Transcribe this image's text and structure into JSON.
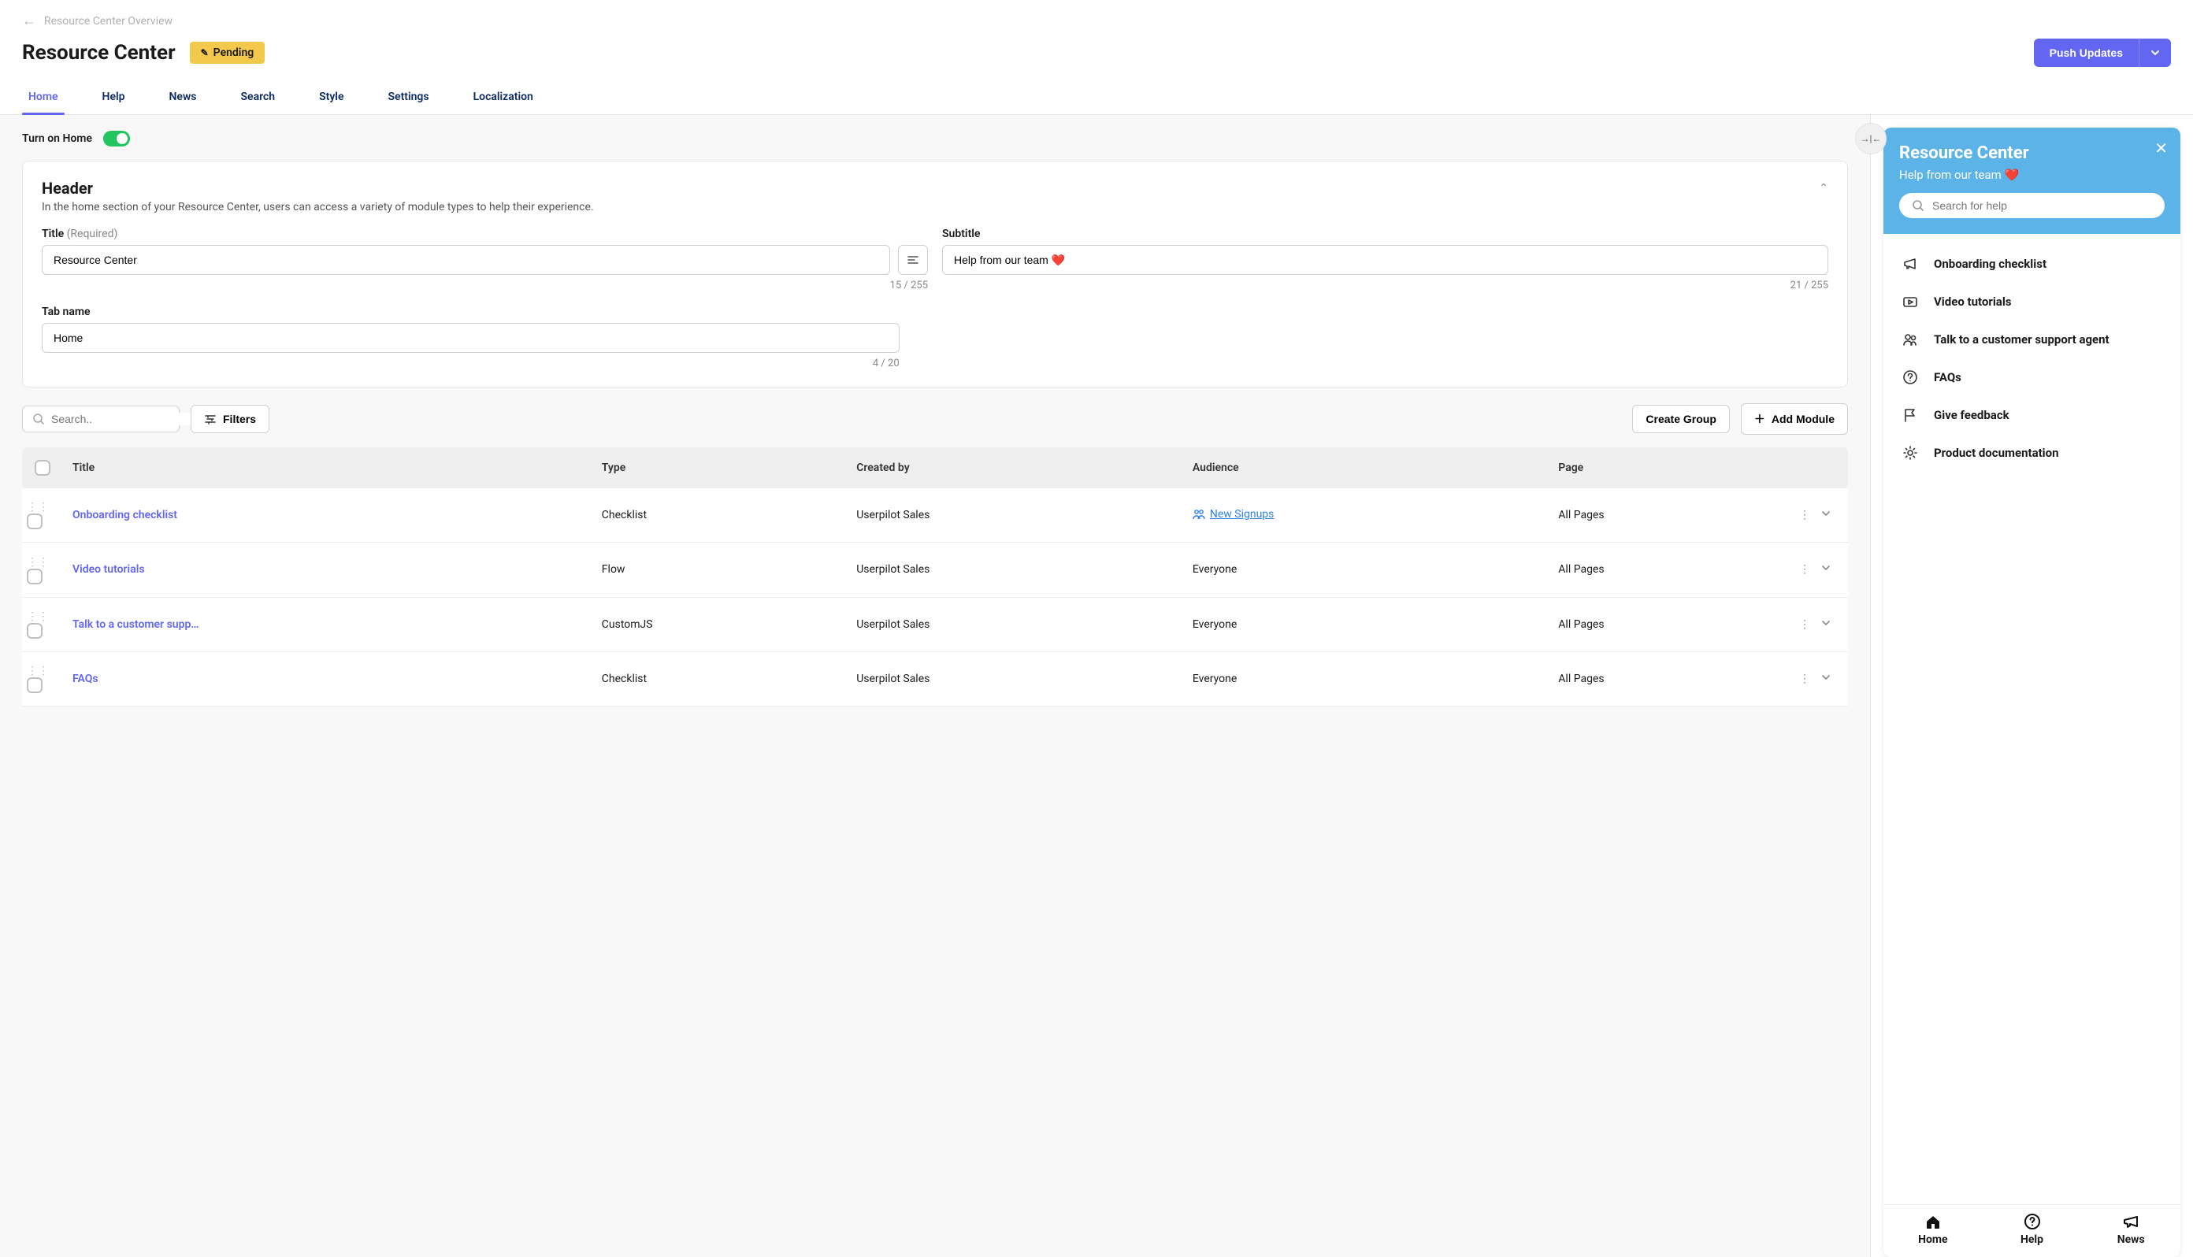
{
  "breadcrumb": {
    "back_label": "Resource Center Overview"
  },
  "page": {
    "title": "Resource Center",
    "badge": "Pending",
    "push_label": "Push Updates"
  },
  "tabs": [
    "Home",
    "Help",
    "News",
    "Search",
    "Style",
    "Settings",
    "Localization"
  ],
  "active_tab": 0,
  "toggle_label": "Turn on Home",
  "header_card": {
    "heading": "Header",
    "desc": "In the home section of your Resource Center, users can access a variety of module types to help their experience.",
    "title_label": "Title",
    "title_required": "(Required)",
    "title_value": "Resource Center",
    "title_counter": "15 / 255",
    "subtitle_label": "Subtitle",
    "subtitle_value": "Help from our team ❤️",
    "subtitle_counter": "21 / 255",
    "tabname_label": "Tab name",
    "tabname_value": "Home",
    "tabname_counter": "4 / 20"
  },
  "toolbar": {
    "search_placeholder": "Search..",
    "filters_label": "Filters",
    "create_group_label": "Create Group",
    "add_module_label": "Add Module"
  },
  "table": {
    "cols": [
      "Title",
      "Type",
      "Created by",
      "Audience",
      "Page"
    ],
    "rows": [
      {
        "title": "Onboarding checklist",
        "type": "Checklist",
        "created_by": "Userpilot Sales",
        "audience": "New Signups",
        "audience_link": true,
        "page": "All Pages"
      },
      {
        "title": "Video tutorials",
        "type": "Flow",
        "created_by": "Userpilot Sales",
        "audience": "Everyone",
        "audience_link": false,
        "page": "All Pages"
      },
      {
        "title": "Talk to a customer supp…",
        "type": "CustomJS",
        "created_by": "Userpilot Sales",
        "audience": "Everyone",
        "audience_link": false,
        "page": "All Pages"
      },
      {
        "title": "FAQs",
        "type": "Checklist",
        "created_by": "Userpilot Sales",
        "audience": "Everyone",
        "audience_link": false,
        "page": "All Pages"
      }
    ]
  },
  "preview": {
    "title": "Resource Center",
    "subtitle": "Help from our team ❤️",
    "search_placeholder": "Search for help",
    "items": [
      {
        "icon": "megaphone",
        "label": "Onboarding checklist"
      },
      {
        "icon": "video",
        "label": "Video tutorials"
      },
      {
        "icon": "people",
        "label": "Talk to a customer support agent"
      },
      {
        "icon": "question",
        "label": "FAQs"
      },
      {
        "icon": "flag",
        "label": "Give feedback"
      },
      {
        "icon": "gear",
        "label": "Product documentation"
      }
    ],
    "nav": [
      {
        "icon": "home",
        "label": "Home"
      },
      {
        "icon": "help",
        "label": "Help"
      },
      {
        "icon": "news",
        "label": "News"
      }
    ]
  }
}
